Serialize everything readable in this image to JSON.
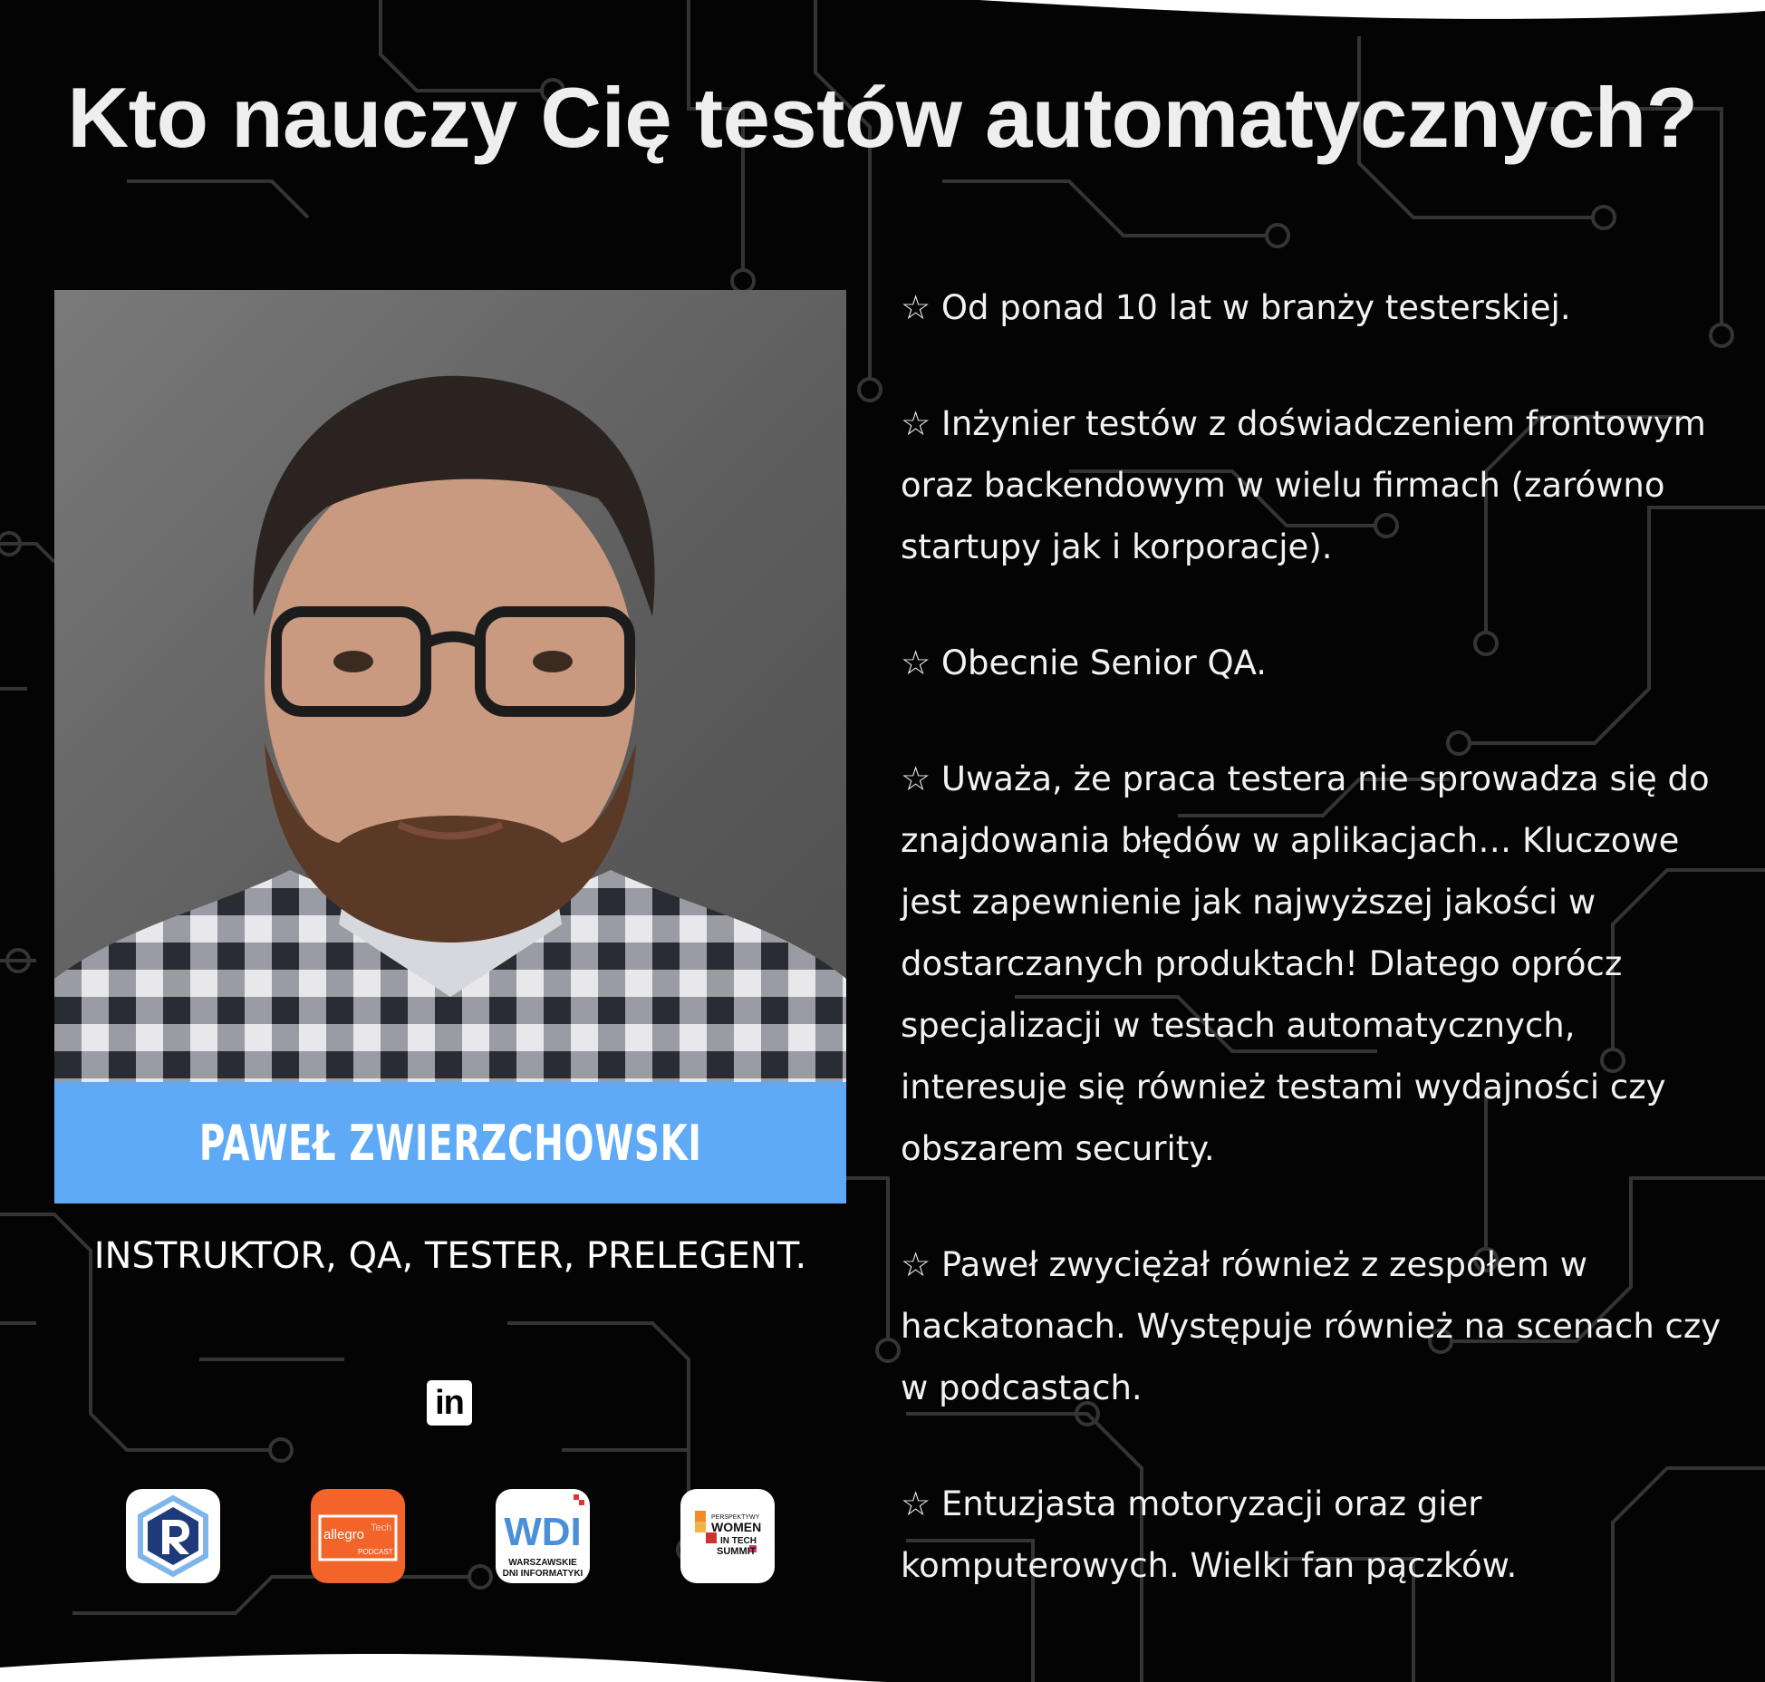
{
  "header": {
    "title": "Kto nauczy Cię testów automatycznych?"
  },
  "profile": {
    "name": "PAWEŁ ZWIERZCHOWSKI",
    "role": "INSTRUKTOR, QA, TESTER, PRELEGENT.",
    "linkedin_label": "in"
  },
  "logos": {
    "allegro": {
      "main": "allegro",
      "suffix": "Tech",
      "sub": "PODCAST"
    },
    "wdi": {
      "main": "WDI",
      "line1": "WARSZAWSKIE",
      "line2": "DNI INFORMATYKI"
    },
    "witsummit": {
      "line1": "PERSPEKTYWY",
      "line2": "WOMEN",
      "line3": "IN TECH",
      "line4": "SUMMIT"
    }
  },
  "bio": [
    "☆ Od ponad 10 lat w branży testerskiej.",
    "☆ Inżynier testów z doświadczeniem frontowym oraz backendowym w wielu firmach (zarówno startupy jak i korporacje).",
    "☆ Obecnie Senior QA.",
    "☆ Uważa, że praca testera nie sprowadza się do znajdowania błędów w aplikacjach… Kluczowe jest  zapewnienie jak najwyższej jakości w dostarczanych produktach! Dlatego oprócz specjalizacji w testach automatycznych, interesuje się również testami wydajności czy obszarem security.",
    "☆ Paweł zwyciężał również z zespołem w hackatonach. Występuje również na scenach czy w podcastach.",
    "☆ Entuzjasta motoryzacji oraz gier komputerowych. Wielki fan pączków."
  ],
  "colors": {
    "background": "#040404",
    "name_bar": "#5eaaf6",
    "text": "#f2f2f2",
    "allegro": "#f2642a",
    "wdi_blue": "#4a90d9"
  }
}
